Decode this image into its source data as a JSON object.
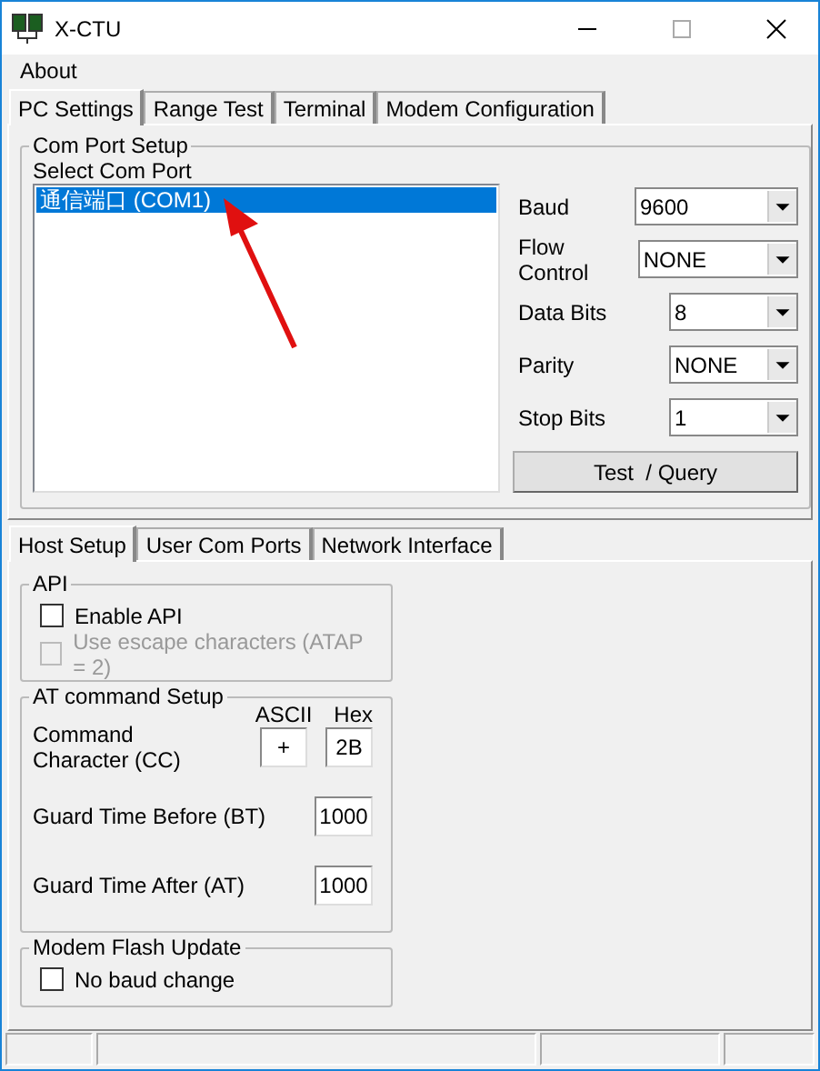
{
  "window": {
    "title": "X-CTU"
  },
  "menu": [
    "About"
  ],
  "tabs": [
    {
      "label": "PC Settings",
      "selected": true
    },
    {
      "label": "Range Test",
      "selected": false
    },
    {
      "label": "Terminal",
      "selected": false
    },
    {
      "label": "Modem Configuration",
      "selected": false
    }
  ],
  "com_port_setup": {
    "title": "Com Port Setup",
    "list_label": "Select Com Port",
    "ports": [
      {
        "label": "通信端口 (COM1)",
        "selected": true
      }
    ],
    "settings": [
      {
        "label": "Baud",
        "value": "9600"
      },
      {
        "label": "Flow Control",
        "value": "NONE"
      },
      {
        "label": "Data Bits",
        "value": "8"
      },
      {
        "label": "Parity",
        "value": "NONE"
      },
      {
        "label": "Stop Bits",
        "value": "1"
      }
    ],
    "test_button": "Test  / Query"
  },
  "host_tabs": [
    {
      "label": "Host Setup",
      "selected": true
    },
    {
      "label": "User Com Ports",
      "selected": false
    },
    {
      "label": "Network Interface",
      "selected": false
    }
  ],
  "api": {
    "title": "API",
    "options": [
      {
        "label": "Enable API",
        "checked": false,
        "disabled": false
      },
      {
        "label": "Use escape characters (ATAP = 2)",
        "checked": false,
        "disabled": true
      }
    ]
  },
  "at_command": {
    "title": "AT command Setup",
    "ascii_label": "ASCII",
    "hex_label": "Hex",
    "fields": [
      {
        "kind": "pair",
        "label": "Command Character (CC)",
        "ascii": "+",
        "hex": "2B"
      },
      {
        "kind": "single",
        "label": "Guard Time Before (BT)",
        "value": "1000"
      },
      {
        "kind": "single",
        "label": "Guard Time After (AT)",
        "value": "1000"
      }
    ]
  },
  "modem_flash": {
    "title": "Modem Flash Update",
    "options": [
      {
        "label": "No baud change",
        "checked": false
      }
    ]
  }
}
